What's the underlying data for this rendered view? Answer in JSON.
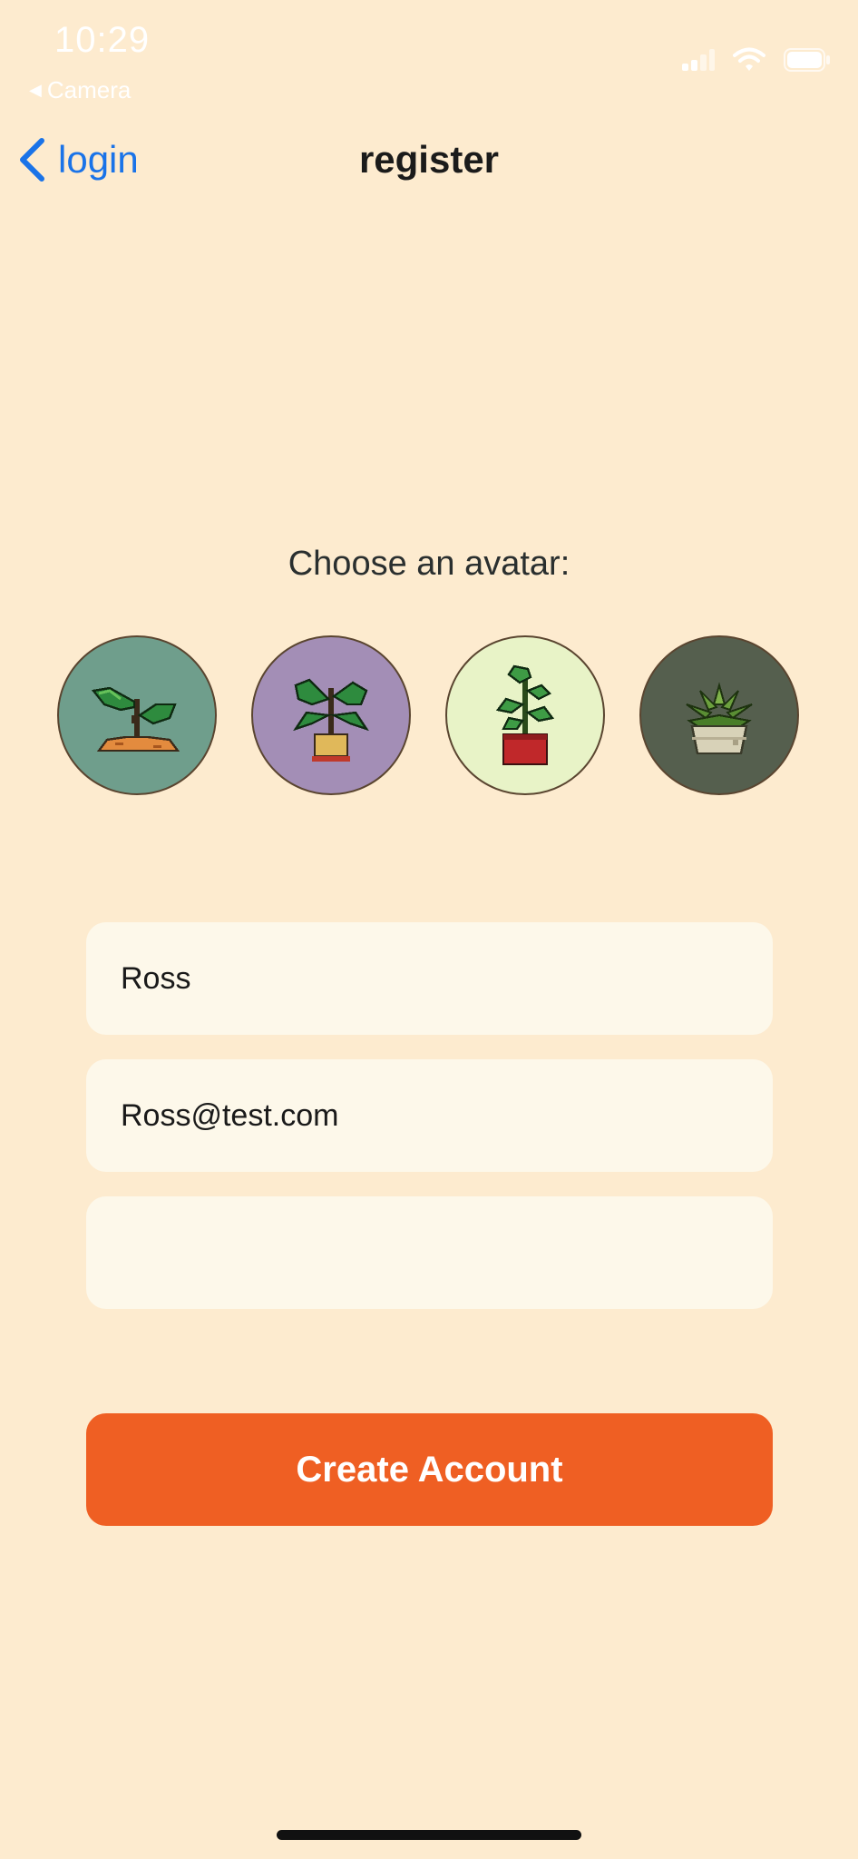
{
  "status_bar": {
    "time": "10:29",
    "back_app": "Camera"
  },
  "nav": {
    "back_label": "login",
    "title": "register"
  },
  "avatar_section": {
    "prompt": "Choose an avatar:",
    "avatars": [
      {
        "name": "seedling",
        "bg": "#6F9E8C"
      },
      {
        "name": "potted-leafy-plant",
        "bg": "#A38EB6"
      },
      {
        "name": "red-pot-plant",
        "bg": "#E8F3C7"
      },
      {
        "name": "succulent",
        "bg": "#555F4E"
      }
    ]
  },
  "form": {
    "name_value": "Ross",
    "email_value": "Ross@test.com",
    "password_value": ""
  },
  "actions": {
    "create_label": "Create Account"
  },
  "colors": {
    "background": "#FDEBCF",
    "accent": "#EF5F23",
    "link": "#1A73E8",
    "field": "#FDF8EA"
  }
}
